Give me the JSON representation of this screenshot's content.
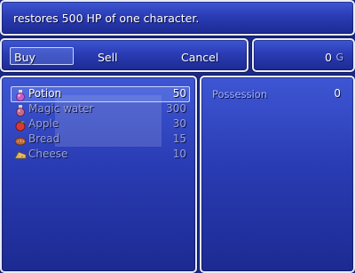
{
  "help": {
    "text": "restores 500 HP of one character."
  },
  "commands": [
    {
      "label": "Buy",
      "selected": true
    },
    {
      "label": "Sell"
    },
    {
      "label": "Cancel"
    }
  ],
  "gold": {
    "value": "0",
    "unit": "G"
  },
  "items": [
    {
      "name": "Potion",
      "price": "50",
      "icon": "potion-icon",
      "selected": true
    },
    {
      "name": "Magic water",
      "price": "300",
      "icon": "magic-water-icon"
    },
    {
      "name": "Apple",
      "price": "30",
      "icon": "apple-icon"
    },
    {
      "name": "Bread",
      "price": "15",
      "icon": "bread-icon"
    },
    {
      "name": "Cheese",
      "price": "10",
      "icon": "cheese-icon"
    }
  ],
  "status": {
    "possession_label": "Possession",
    "possession_value": "0"
  },
  "colors": {
    "window_top": "#3e56d4",
    "window_bottom": "#1c2a92",
    "border": "#e8eaf4",
    "system_text": "#9fb0ff"
  }
}
